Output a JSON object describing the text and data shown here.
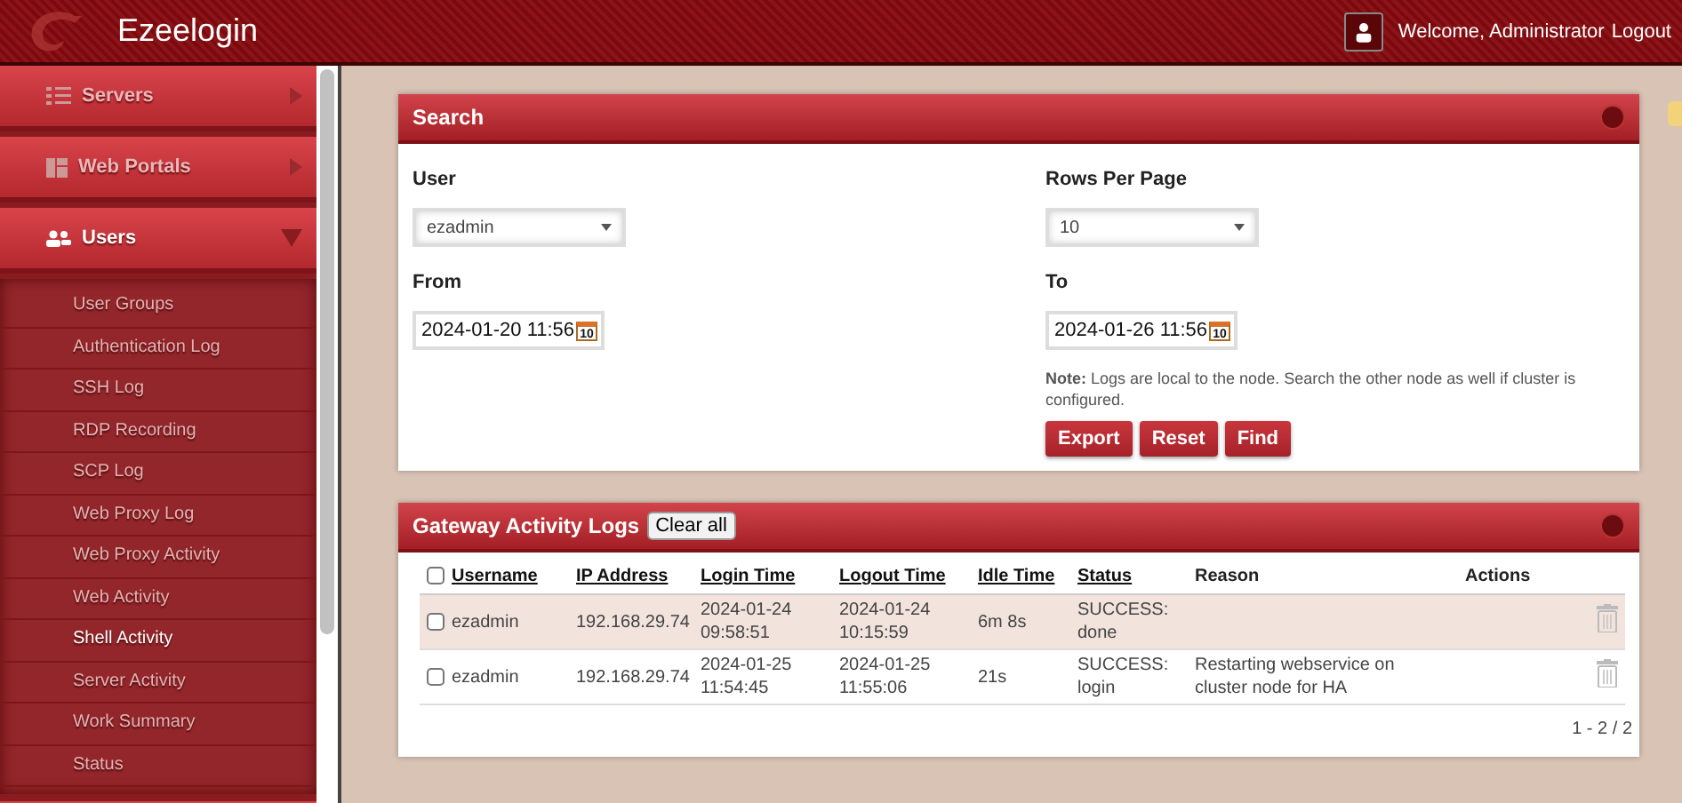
{
  "header": {
    "brand": "Ezeelogin",
    "welcome": "Welcome, Administrator",
    "logout": "Logout"
  },
  "sidebar": {
    "items": [
      {
        "label": "Servers",
        "kind": "list",
        "expanded": false
      },
      {
        "label": "Web Portals",
        "kind": "panels",
        "expanded": false
      },
      {
        "label": "Users",
        "kind": "users",
        "expanded": true,
        "children": [
          {
            "label": "User Groups",
            "selected": false
          },
          {
            "label": "Authentication Log",
            "selected": false
          },
          {
            "label": "SSH Log",
            "selected": false
          },
          {
            "label": "RDP Recording",
            "selected": false
          },
          {
            "label": "SCP Log",
            "selected": false
          },
          {
            "label": "Web Proxy Log",
            "selected": false
          },
          {
            "label": "Web Proxy Activity",
            "selected": false
          },
          {
            "label": "Web Activity",
            "selected": false
          },
          {
            "label": "Shell Activity",
            "selected": true
          },
          {
            "label": "Server Activity",
            "selected": false
          },
          {
            "label": "Work Summary",
            "selected": false
          },
          {
            "label": "Status",
            "selected": false
          }
        ]
      }
    ]
  },
  "search": {
    "title": "Search",
    "user_label": "User",
    "user_value": "ezadmin",
    "rows_label": "Rows Per Page",
    "rows_value": "10",
    "from_label": "From",
    "from_value": "2024-01-20 11:56",
    "to_label": "To",
    "to_value": "2024-01-26 11:56",
    "from_calendar_day": "10",
    "to_calendar_day": "10",
    "note": "**Note:** Logs are local to the node. Search the other node as well if cluster is configured.",
    "buttons": [
      "Export",
      "Reset",
      "Find"
    ]
  },
  "logs": {
    "title": "Gateway Activity Logs",
    "clear_button": "Clear all",
    "select_all_checked": false,
    "columns": [
      {
        "label": "Username",
        "sortable": true
      },
      {
        "label": "IP Address",
        "sortable": true
      },
      {
        "label": "Login Time",
        "sortable": true
      },
      {
        "label": "Logout Time",
        "sortable": true
      },
      {
        "label": "Idle Time",
        "sortable": true
      },
      {
        "label": "Status",
        "sortable": true
      },
      {
        "label": "Reason",
        "sortable": false
      },
      {
        "label": "Actions",
        "sortable": false
      }
    ],
    "rows": [
      {
        "highlighted": true,
        "checked": false,
        "cells": [
          "ezadmin",
          "192.168.29.74",
          "2024-01-24 09:58:51",
          "2024-01-24 10:15:59",
          "6m 8s",
          "SUCCESS: done",
          ""
        ]
      },
      {
        "highlighted": false,
        "checked": false,
        "cells": [
          "ezadmin",
          "192.168.29.74",
          "2024-01-25 11:54:45",
          "2024-01-25 11:55:06",
          "21s",
          "SUCCESS: login",
          "Restarting webservice on cluster node for HA"
        ]
      }
    ],
    "pagination": "1 - 2 / 2"
  }
}
